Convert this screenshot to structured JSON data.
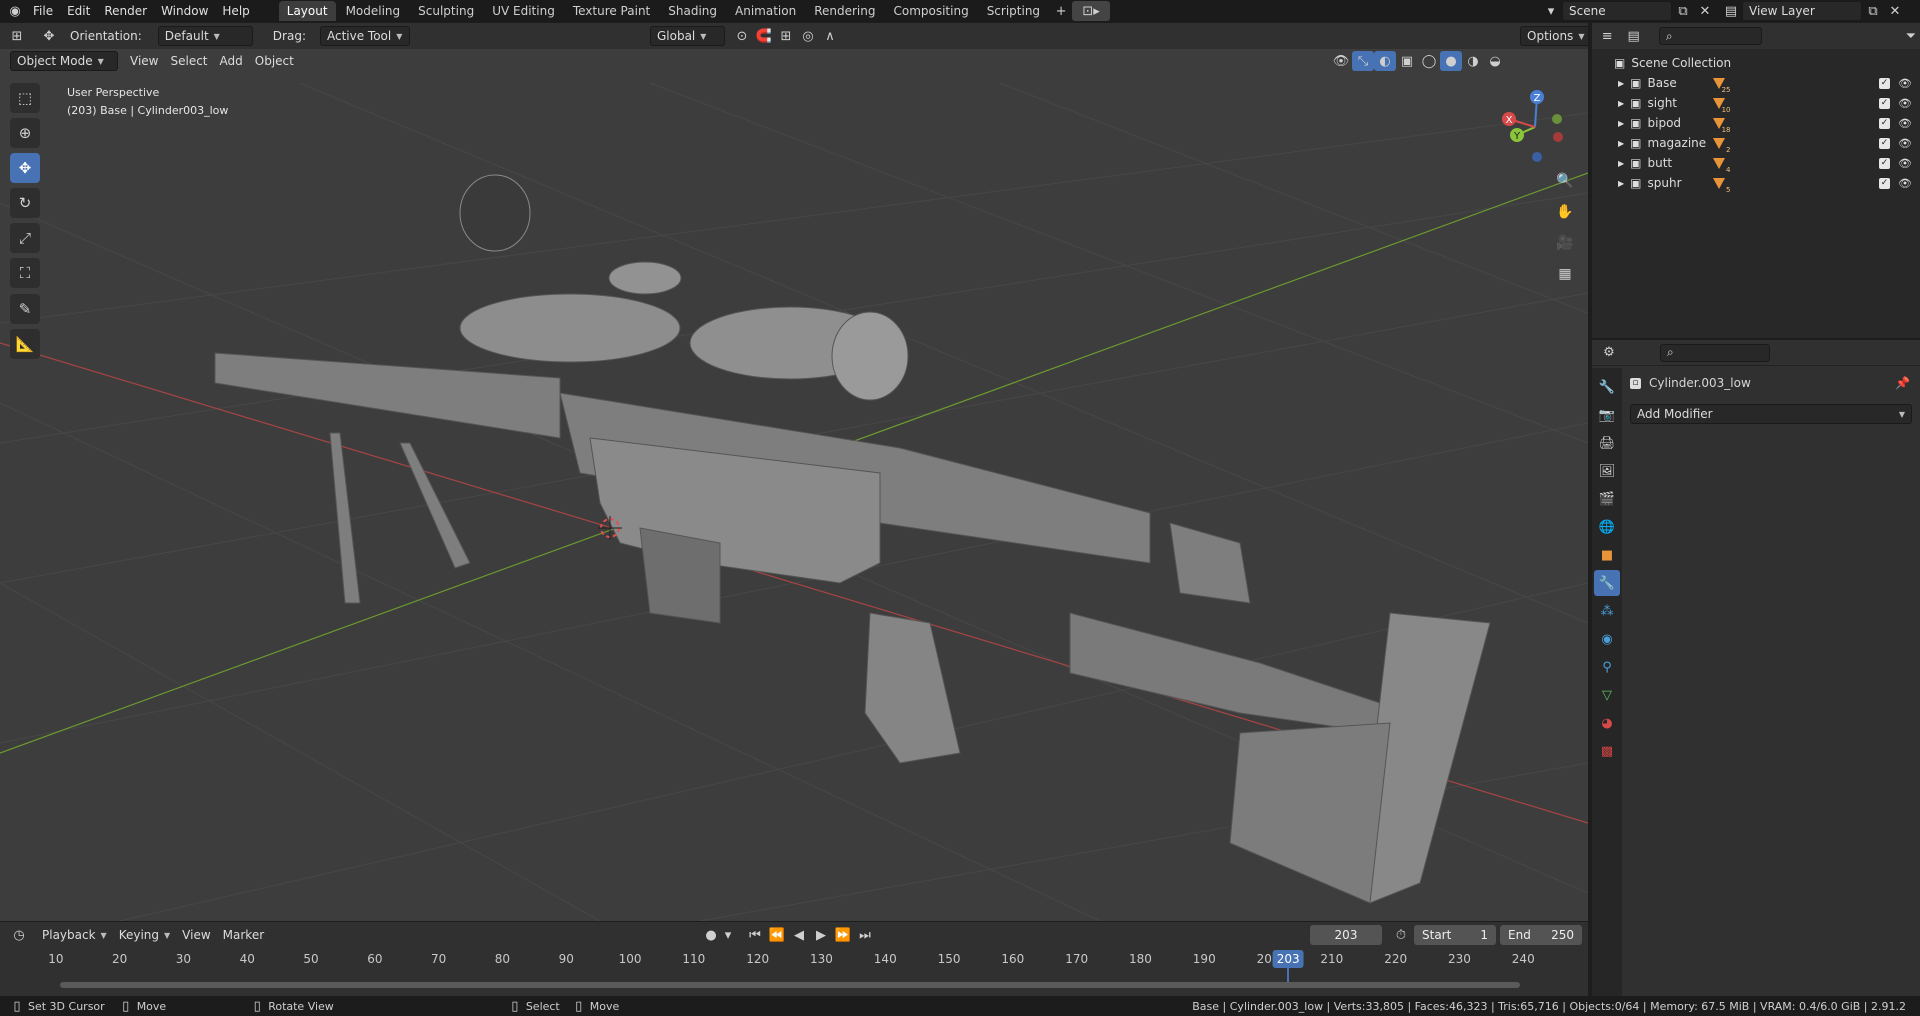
{
  "topbar": {
    "menus": [
      "File",
      "Edit",
      "Render",
      "Window",
      "Help"
    ],
    "workspaces": [
      "Layout",
      "Modeling",
      "Sculpting",
      "UV Editing",
      "Texture Paint",
      "Shading",
      "Animation",
      "Rendering",
      "Compositing",
      "Scripting"
    ],
    "active_workspace": "Layout",
    "scene": "Scene",
    "view_layer": "View Layer"
  },
  "viewport": {
    "orientation_label": "Orientation:",
    "orientation_value": "Default",
    "drag_label": "Drag:",
    "drag_value": "Active Tool",
    "transform_orientation": "Global",
    "options_label": "Options",
    "mode": "Object Mode",
    "menu": [
      "View",
      "Select",
      "Add",
      "Object"
    ],
    "overlay_title": "User Perspective",
    "overlay_subtitle": "(203) Base | Cylinder003_low",
    "gizmo_axes": [
      "X",
      "Y",
      "Z"
    ]
  },
  "outliner": {
    "root": "Scene Collection",
    "items": [
      {
        "name": "Base",
        "badge": "25"
      },
      {
        "name": "sight",
        "badge": "10"
      },
      {
        "name": "bipod",
        "badge": "18"
      },
      {
        "name": "magazine",
        "badge": "2"
      },
      {
        "name": "butt",
        "badge": "4"
      },
      {
        "name": "spuhr",
        "badge": "5"
      }
    ]
  },
  "properties": {
    "object_name": "Cylinder.003_low",
    "add_modifier": "Add Modifier"
  },
  "timeline": {
    "menus": [
      "Playback",
      "Keying",
      "View",
      "Marker"
    ],
    "current_frame": "203",
    "start_label": "Start",
    "start_value": "1",
    "end_label": "End",
    "end_value": "250",
    "ticks": [
      "10",
      "20",
      "30",
      "40",
      "50",
      "60",
      "70",
      "80",
      "90",
      "100",
      "110",
      "120",
      "130",
      "140",
      "150",
      "160",
      "170",
      "180",
      "190",
      "200",
      "210",
      "220",
      "230",
      "240"
    ],
    "playhead_label": "203"
  },
  "statusbar": {
    "hints": [
      "Set 3D Cursor",
      "Move",
      "Rotate View",
      "Select",
      "Move"
    ],
    "stats": "Base | Cylinder.003_low | Verts:33,805 | Faces:46,323 | Tris:65,716 | Objects:0/64 | Memory: 67.5 MiB | VRAM: 0.4/6.0 GiB | 2.91.2"
  },
  "colors": {
    "accent": "#4772b3",
    "x_axis": "#d84a4a",
    "y_axis": "#8ac43a",
    "z_axis": "#4a7fd8",
    "object_badge": "#e8953a"
  }
}
